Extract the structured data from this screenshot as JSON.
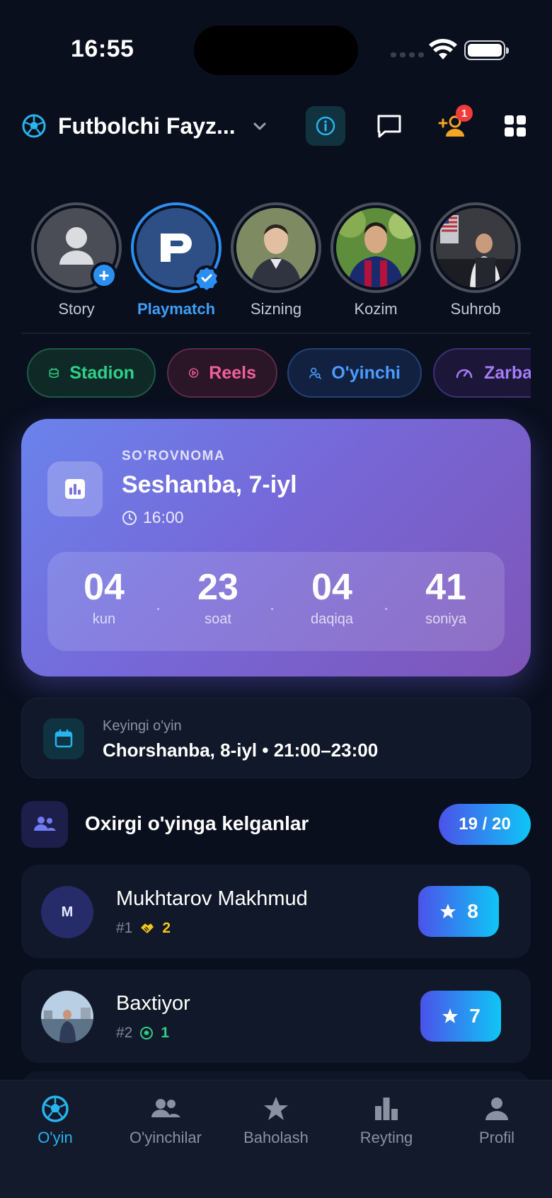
{
  "status_bar": {
    "time": "16:55"
  },
  "header": {
    "title": "Futbolchi Fayz...",
    "notification_count": "1"
  },
  "stories": [
    {
      "label": "Story",
      "active": false
    },
    {
      "label": "Playmatch",
      "active": true
    },
    {
      "label": "Sizning",
      "active": false
    },
    {
      "label": "Kozim",
      "active": false
    },
    {
      "label": "Suhrob",
      "active": false
    }
  ],
  "chips": [
    {
      "label": "Stadion"
    },
    {
      "label": "Reels"
    },
    {
      "label": "O'yinchi"
    },
    {
      "label": "Zarba"
    }
  ],
  "poll": {
    "kicker": "SO'ROVNOMA",
    "title": "Seshanba, 7-iyl",
    "time": "16:00",
    "countdown": [
      {
        "value": "04",
        "label": "kun"
      },
      {
        "value": "23",
        "label": "soat"
      },
      {
        "value": "04",
        "label": "daqiqa"
      },
      {
        "value": "41",
        "label": "soniya"
      }
    ],
    "separator": "."
  },
  "next_game": {
    "label": "Keyingi o'yin",
    "value": "Chorshanba, 8-iyl • 21:00–23:00"
  },
  "attendance": {
    "title": "Oxirgi o'yinga kelganlar",
    "count": "19 / 20"
  },
  "players": [
    {
      "initial": "M",
      "name": "Mukhtarov Makhmud",
      "rank": "#1",
      "stat": "2",
      "stat_icon": "handshake-icon",
      "score": "8"
    },
    {
      "initial": "",
      "name": "Baxtiyor",
      "rank": "#2",
      "stat": "1",
      "stat_icon": "football-icon",
      "score": "7"
    }
  ],
  "tabs": [
    {
      "label": "O'yin",
      "active": true
    },
    {
      "label": "O'yinchilar",
      "active": false
    },
    {
      "label": "Baholash",
      "active": false
    },
    {
      "label": "Reyting",
      "active": false
    },
    {
      "label": "Profil",
      "active": false
    }
  ],
  "colors": {
    "background": "#0a0f1e",
    "accent": "#2b8ff0",
    "cyan": "#27b4ef",
    "stadion": "#2fd08a",
    "reels": "#f25f9b",
    "oyinchi": "#4c9bff",
    "zarba": "#a47cf8",
    "badge_red": "#ef3b3b"
  }
}
